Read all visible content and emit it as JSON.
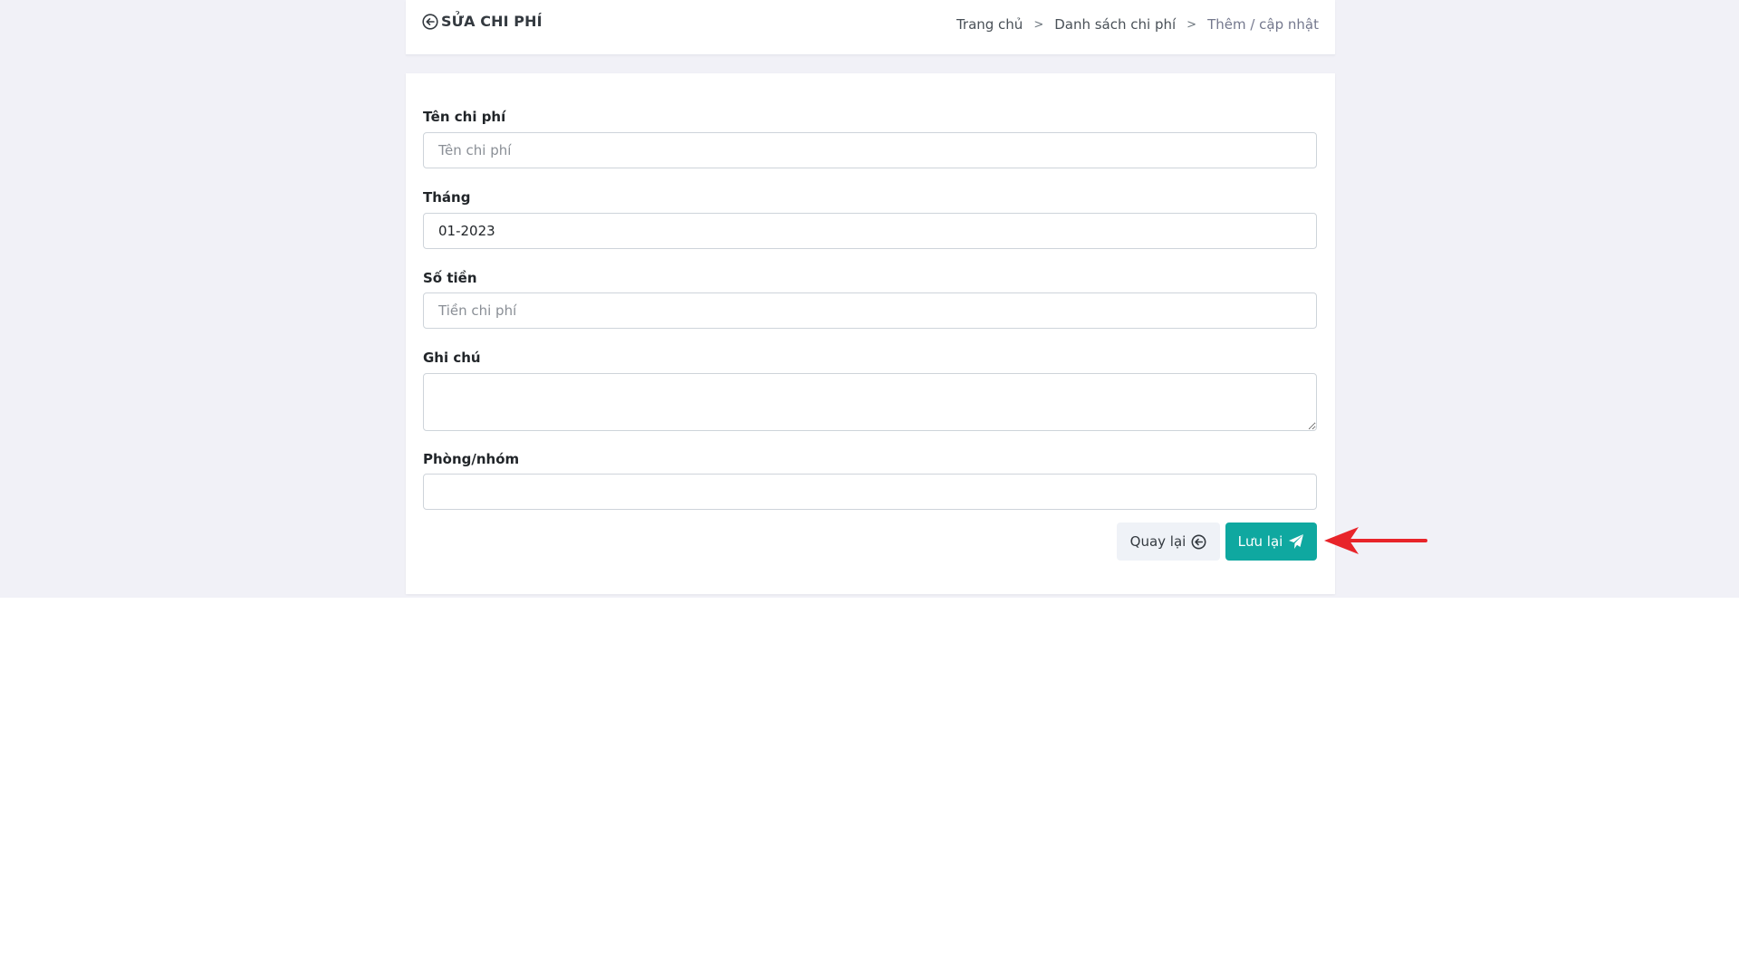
{
  "header": {
    "title": "SỬA CHI PHÍ",
    "back_icon": "circle-arrow-left-icon",
    "breadcrumb": {
      "items": [
        "Trang chủ",
        "Danh sách chi phí",
        "Thêm / cập nhật"
      ],
      "separator": ">"
    }
  },
  "form": {
    "fields": [
      {
        "label": "Tên chi phí",
        "value": "",
        "placeholder": "Tên chi phí"
      },
      {
        "label": "Tháng",
        "value": "01-2023",
        "placeholder": ""
      },
      {
        "label": "Số tiền",
        "value": "",
        "placeholder": "Tiền chi phí"
      },
      {
        "label": "Ghi chú",
        "value": "",
        "placeholder": ""
      },
      {
        "label": "Phòng/nhóm",
        "value": "",
        "placeholder": ""
      }
    ],
    "buttons": {
      "back_label": "Quay lại",
      "back_icon": "circle-arrow-left-icon",
      "save_label": "Lưu lại",
      "save_icon": "paper-plane-icon"
    }
  },
  "colors": {
    "primary": "#0fa8a0",
    "page_background": "#f1f1f7",
    "annotation_arrow": "#e8242a"
  }
}
